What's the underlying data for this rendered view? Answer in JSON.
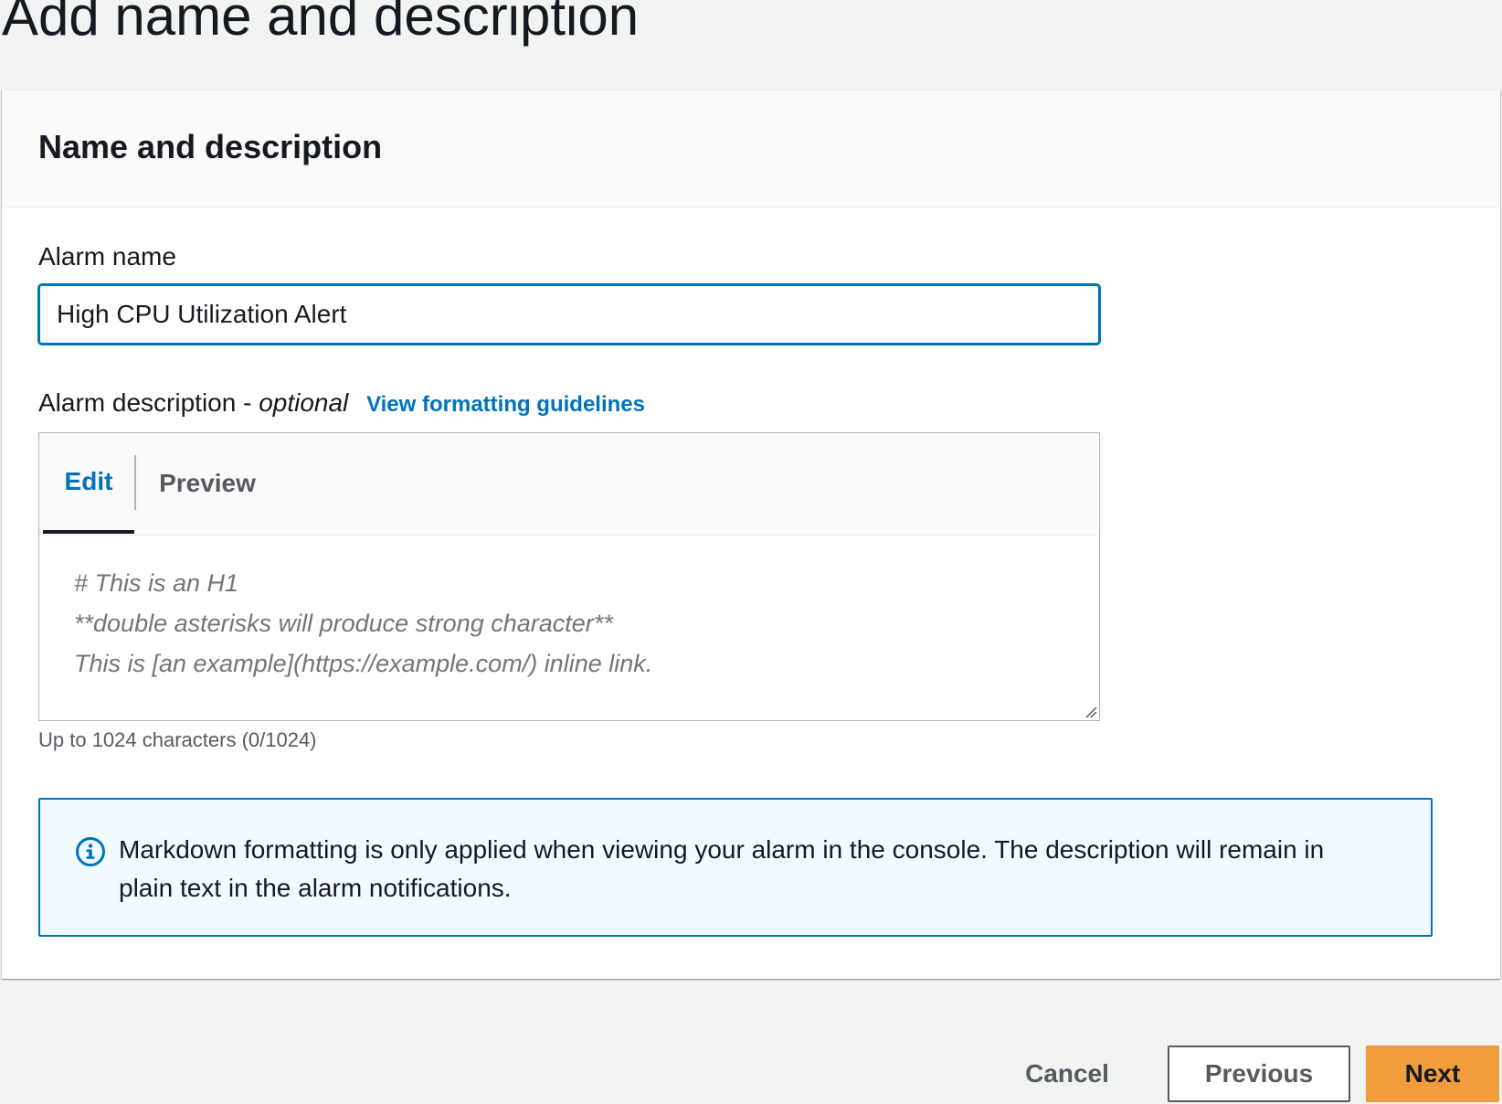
{
  "page": {
    "title": "Add name and description"
  },
  "panel": {
    "title": "Name and description"
  },
  "alarm_name": {
    "label": "Alarm name",
    "value": "High CPU Utilization Alert"
  },
  "alarm_description": {
    "label": "Alarm description - ",
    "optional_label": "optional",
    "guidelines_link": "View formatting guidelines",
    "tabs": {
      "edit": "Edit",
      "preview": "Preview",
      "active": "edit"
    },
    "value": "",
    "placeholder": "# This is an H1\n**double asterisks will produce strong character**\nThis is [an example](https://example.com/) inline link.",
    "constraint": "Up to 1024 characters (0/1024)"
  },
  "info": {
    "icon": "info-icon",
    "text": "Markdown formatting is only applied when viewing your alarm in the console. The description will remain in plain text in the alarm notifications."
  },
  "actions": {
    "cancel": "Cancel",
    "previous": "Previous",
    "next": "Next"
  },
  "colors": {
    "link": "#0073bb",
    "primary_button": "#f29d3c",
    "info_background": "#f1faff",
    "info_border": "#0073bb",
    "page_background": "#f2f3f3"
  }
}
